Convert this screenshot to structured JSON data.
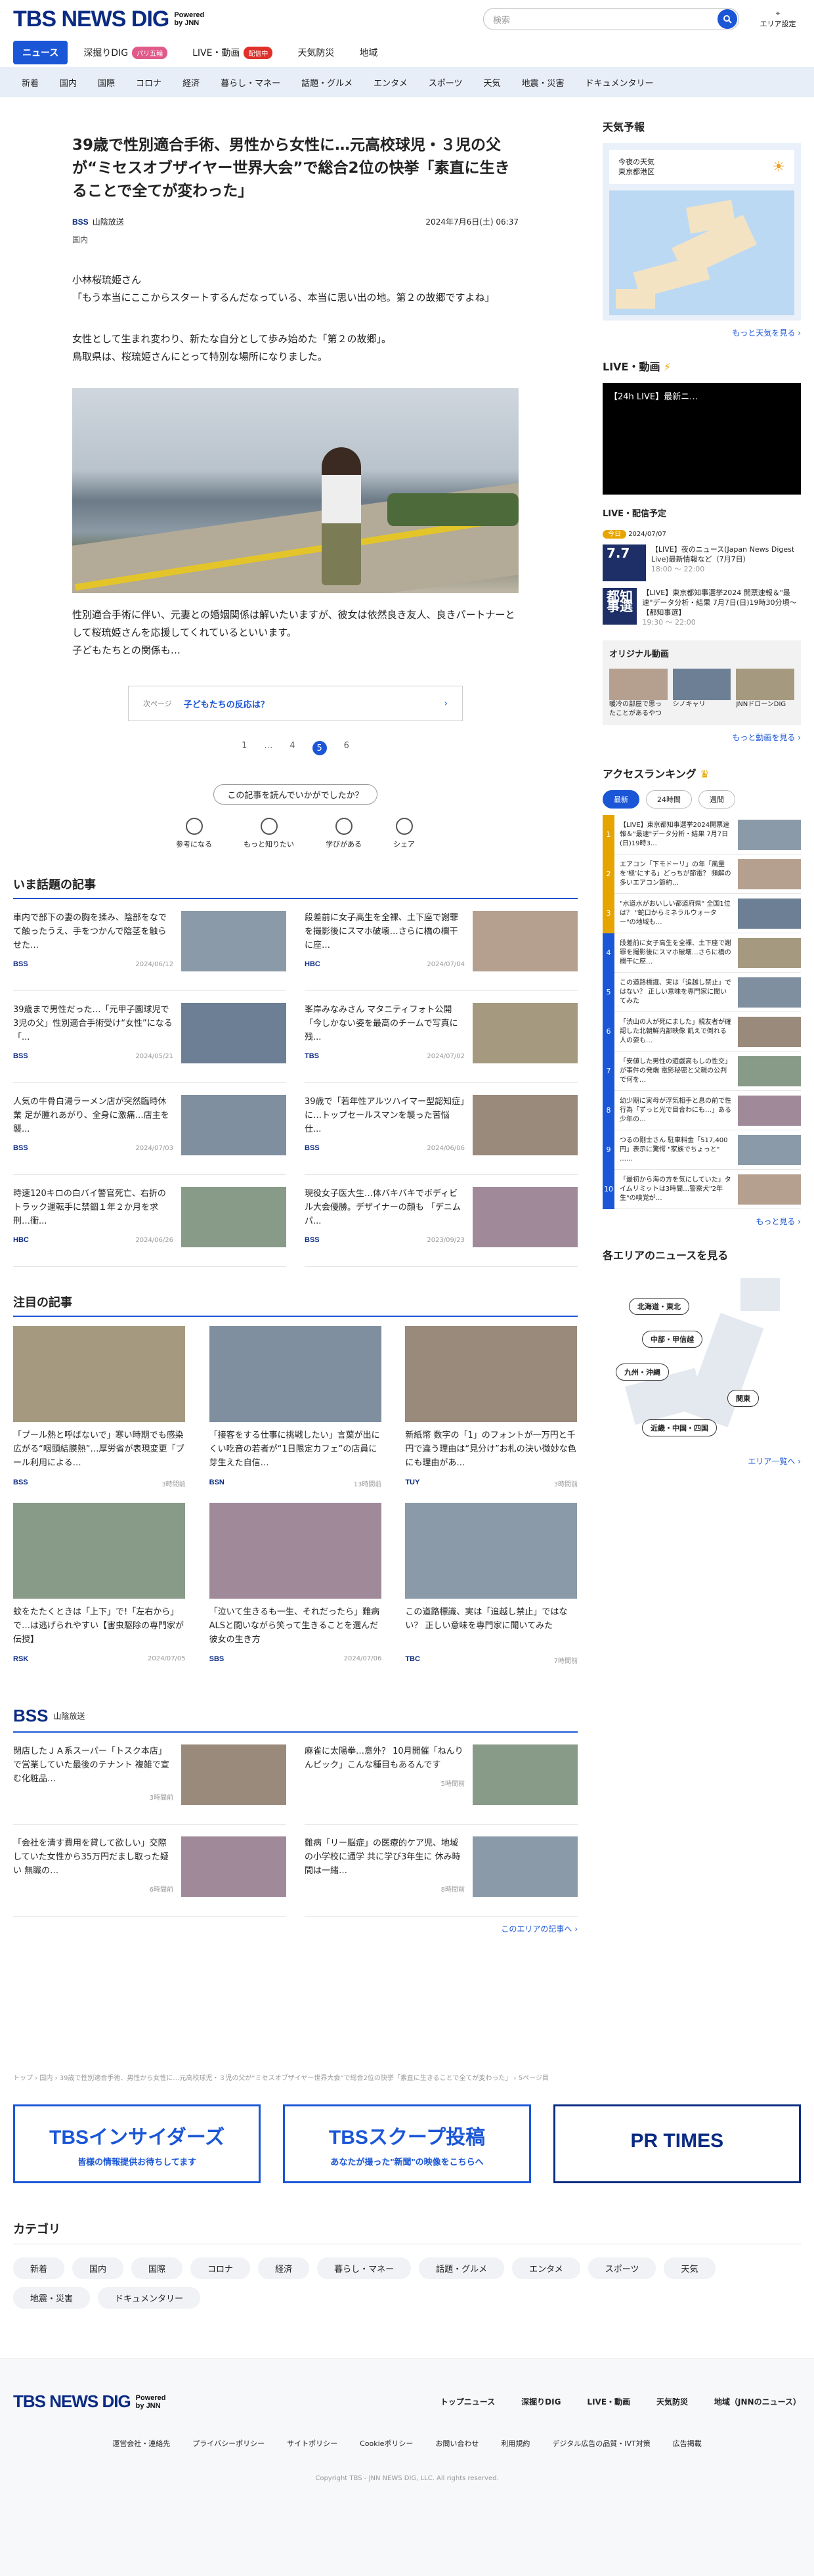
{
  "header": {
    "logo": "TBS NEWS DIG",
    "powered_line1": "Powered",
    "powered_line2": "by JNN",
    "search_placeholder": "検索",
    "area_label": "エリア設定"
  },
  "nav_main": [
    {
      "label": "ニュース",
      "active": true
    },
    {
      "label": "深掘りDIG",
      "badge": "パリ五輪",
      "badge_color": "#e05a8a"
    },
    {
      "label": "LIVE・動画",
      "badge": "配信中",
      "badge_color": "#e0302a"
    },
    {
      "label": "天気防災"
    },
    {
      "label": "地域"
    }
  ],
  "nav_sub": [
    "新着",
    "国内",
    "国際",
    "コロナ",
    "経済",
    "暮らし・マネー",
    "話題・グルメ",
    "エンタメ",
    "スポーツ",
    "天気",
    "地震・災害",
    "ドキュメンタリー"
  ],
  "article": {
    "title": "39歳で性別適合手術、男性から女性に…元高校球児・３児の父が“ミセスオブザイヤー世界大会”で総合2位の快挙「素直に生きることで全てが変わった」",
    "source": "BSS",
    "source_name": "山陰放送",
    "date": "2024年7月6日(土) 06:37",
    "category": "国内",
    "p1": "小林桜琉姫さん",
    "p2": "「もう本当にここからスタートするんだなっている、本当に思い出の地。第２の故郷ですよね」",
    "p3": "女性として生まれ変わり、新たな自分として歩み始めた「第２の故郷」。",
    "p4": "鳥取県は、桜琉姫さんにとって特別な場所になりました。",
    "p5": "性別適合手術に伴い、元妻との婚姻関係は解いたいますが、彼女は依然良き友人、良きパートナーとして桜琉姫さんを応援してくれているといいます。",
    "p6": "子どもたちとの関係も…",
    "next_label": "次ページ",
    "next_text": "子どもたちの反応は？",
    "pages": [
      "1",
      "…",
      "4",
      "5",
      "6"
    ],
    "feedback_q": "この記事を読んでいかがでしたか？",
    "feedback": [
      "参考になる",
      "もっと知りたい",
      "学びがある",
      "シェア"
    ]
  },
  "trending": {
    "title": "いま話題の記事",
    "items": [
      {
        "text": "車内で部下の妻の胸を揉み、陰部をなでて触ったうえ、手をつかんで陰茎を触らせた…",
        "src": "BSS",
        "date": "2024/06/12"
      },
      {
        "text": "段差前に女子高生を全裸、土下座で謝罪を撮影後にスマホ破壊…さらに橋の欄干に座…",
        "src": "HBC",
        "date": "2024/07/04"
      },
      {
        "text": "39歳まで男性だった…「元甲子園球児で3児の父」性別適合手術受け“女性”になる「...",
        "src": "BSS",
        "date": "2024/05/21"
      },
      {
        "text": "峯岸みなみさん マタニティフォト公開 「今しかない姿を最高のチームで写真に残...",
        "src": "TBS",
        "date": "2024/07/02"
      },
      {
        "text": "人気の牛骨白湯ラーメン店が突然臨時休業 足が腫れあがり、全身に激痛…店主を襲...",
        "src": "BSS",
        "date": "2024/07/03"
      },
      {
        "text": "39歳で「若年性アルツハイマー型認知症」に…トップセールスマンを襲った苦悩 仕...",
        "src": "BSS",
        "date": "2024/06/06"
      },
      {
        "text": "時速120キロの白バイ警官死亡、右折のトラック運転手に禁錮１年２か月を求刑…衝...",
        "src": "HBC",
        "date": "2024/06/26"
      },
      {
        "text": "現役女子医大生…体バキバキでボディビル大会優勝。デザイナーの顔も 「デニムパ...",
        "src": "BSS",
        "date": "2023/09/23"
      }
    ]
  },
  "featured": {
    "title": "注目の記事",
    "items": [
      {
        "text": "「プール熱と呼ばないで」寒い時期でも感染広がる“咽頭結膜熱”…厚労省が表現変更「プール利用による…",
        "src": "BSS",
        "date": "3時間前"
      },
      {
        "text": "「接客をする仕事に挑戦したい」言葉が出にくい吃音の若者が“1日限定カフェ”の店員に 芽生えた自信…",
        "src": "BSN",
        "date": "13時間前"
      },
      {
        "text": "新紙幣 数字の「1」のフォントが一万円と千円で違う理由は“見分け”お札の決い微妙な色にも理由があ…",
        "src": "TUY",
        "date": "3時間前"
      },
      {
        "text": "蚊をたたくときは「上下」で!「左右から」で…は逃げられやすい【害虫駆除の専門家が伝授】",
        "src": "RSK",
        "date": "2024/07/05"
      },
      {
        "text": "「泣いて生きるも一生、それだったら」難病ALSと闘いながら笑って生きることを選んだ彼女の生き方",
        "src": "SBS",
        "date": "2024/07/06"
      },
      {
        "text": "この道路標識、実は「追越し禁止」ではない？ 正しい意味を専門家に聞いてみた",
        "src": "TBC",
        "date": "7時間前"
      }
    ]
  },
  "bss": {
    "logo": "BSS",
    "name": "山陰放送",
    "items": [
      {
        "text": "閉店したＪＡ系スーパー「トスク本店」で営業していた最後のテナント 複雑で宣む化粧品…",
        "date": "3時間前"
      },
      {
        "text": "麻雀に太陽拳…意外？ 10月開催「ねんりんピック」こんな種目もあるんです",
        "date": "5時間前"
      },
      {
        "text": "「会社を清す費用を貸して欲しい」交際していた女性から35万円だまし取った疑い 無職の…",
        "date": "6時間前"
      },
      {
        "text": "難病「リー脳症」の医療的ケア児、地域の小学校に通学 共に学び3年生に 休み時間は一緒…",
        "date": "8時間前"
      }
    ],
    "more": "このエリアの記事へ ›"
  },
  "sidebar": {
    "weather_title": "天気予報",
    "weather_line1": "今夜の天気",
    "weather_line2": "東京都港区",
    "weather_more": "もっと天気を見る ›",
    "live_title": "LIVE・動画",
    "live_video_title": "【24h LIVE】最新ニ…",
    "sched_title": "LIVE・配信予定",
    "sched_badge": "今日",
    "sched_date": "2024/07/07",
    "sched": [
      {
        "text": "【LIVE】夜のニュース(Japan News Digest Live)最新情報など（7月7日）",
        "time": "18:00 〜 22:00",
        "thumb": "7.7"
      },
      {
        "text": "【LIVE】東京都知事選挙2024 開票速報＆\"最速\"データ分析・結果 7月7日(日)19時30分頃〜【都知事選】",
        "time": "19:30 〜 22:00",
        "thumb": "都知事選"
      }
    ],
    "orig_title": "オリジナル動画",
    "orig": [
      "暖冷の部屋で思ったことがあるやつ",
      "シノキャリ",
      "JNNドローンDIG"
    ],
    "more_video": "もっと動画を見る ›",
    "rank_title": "アクセスランキング",
    "rank_tabs": [
      "最新",
      "24時間",
      "週間"
    ],
    "rank": [
      "【LIVE】東京都知事選挙2024開票速報＆\"最速\"データ分析・結果 7月7日(日)19時3…",
      "エアコン「下モドーリ」の年「風量を‘極’にする」どっちが節電？ 頻解の多いエアコン節約…",
      "\"水道水がおいしい都道府県\" 全国1位は？ \"蛇口からミネラルウォーター\"の地域も…",
      "段差前に女子高生を全裸、土下座で謝罪を撮影後にスマホ破壊…さらに橋の欄干に座…",
      "この道路標識、実は「追越し禁止」ではない？ 正しい意味を専門家に聞いてみた",
      "「渋山の人が死にました」親友者が確認した北朝鮮内部映像 飢えで倒れる人の姿も…",
      "「安値した男性の遊戯高もしの性交」が事件の発端 電影秘密と父親の公判で何を…",
      "幼少期に実母が浮気相手と息の前で性行為「ずっと光で目合わにも…」ある少年の…",
      "つるの剛士さん 駐車料金「517,400円」表示に驚愕 \"家族でちょっと\" ……",
      "「最初から海の方を気にしていた」タイムリミットは3時間…警察犬\"2年生\"の嗅覚が…"
    ],
    "more_rank": "もっと見る ›",
    "area_title": "各エリアのニュースを見る",
    "areas": [
      "北海道・東北",
      "中部・甲信越",
      "九州・沖縄",
      "関東",
      "近畿・中国・四国"
    ],
    "area_more": "エリア一覧へ ›"
  },
  "breadcrumb": "トップ › 国内 › 39歳で性別適合手術、男性から女性に…元高校球児・３児の父が“ミセスオブザイヤー世界大会”で総合2位の快挙「素直に生きることで全てが変わった」 › 5ページ目",
  "banners": [
    {
      "title": "TBSインサイダーズ",
      "sub": "皆様の情報提供お待ちしてます",
      "color": "#1a56d6"
    },
    {
      "title": "TBSスクープ投稿",
      "sub": "あなたが撮った\"新聞\"の映像をこちらへ",
      "color": "#1a56d6"
    },
    {
      "title": "PR TIMES",
      "sub": "",
      "color": "#0b2b83"
    }
  ],
  "categories": {
    "title": "カテゴリ",
    "items": [
      "新着",
      "国内",
      "国際",
      "コロナ",
      "経済",
      "暮らし・マネー",
      "話題・グルメ",
      "エンタメ",
      "スポーツ",
      "天気",
      "地震・災害",
      "ドキュメンタリー"
    ]
  },
  "footer": {
    "nav": [
      "トップニュース",
      "深掘りDIG",
      "LIVE・動画",
      "天気防災",
      "地域（JNNのニュース）"
    ],
    "links": [
      "運営会社・連絡先",
      "プライバシーポリシー",
      "サイトポリシー",
      "Cookieポリシー",
      "お問い合わせ",
      "利用規約",
      "デジタル広告の品質・IVT対策",
      "広告掲載"
    ],
    "copyright": "Copyright TBS - JNN NEWS DIG, LLC. All rights reserved."
  }
}
